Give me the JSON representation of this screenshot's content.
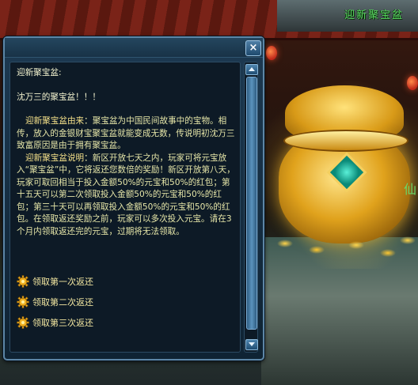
{
  "scene": {
    "title": "迎新聚宝盆",
    "side_char": "仙"
  },
  "dialog": {
    "close_label": "×",
    "heading": "迎新聚宝盆:",
    "greeting": "沈万三的聚宝盆！！！",
    "para1_label": "迎新聚宝盆由来",
    "para1_text": "：聚宝盆为中国民间故事中的宝物。相传，放入的金银财宝聚宝盆就能变成无数，传说明初沈万三致富原因是由于拥有聚宝盆。",
    "para2_label": "迎新聚宝盆说明",
    "para2_text": "：新区开放七天之内，玩家可将元宝放入“聚宝盆”中，它将返还您数倍的奖励！新区开放第八天，玩家可取回相当于投入金额50%的元宝和50%的红包；第十五天可以第二次领取投入金额50%的元宝和50%的红包；第三十天可以再领取投入金额50%的元宝和50%的红包。在领取返还奖励之前，玩家可以多次投入元宝。请在3个月内领取返还完的元宝，过期将无法领取。",
    "actions": [
      {
        "label": "领取第一次返还",
        "icon": "gear-icon"
      },
      {
        "label": "领取第二次返还",
        "icon": "gear-icon"
      },
      {
        "label": "领取第三次返还",
        "icon": "gear-icon"
      }
    ]
  },
  "colors": {
    "panel_bg": "#0d1a26",
    "frame": "#5c86a6",
    "text": "#e6e6a8",
    "highlight": "#f6e28a",
    "scene_title": "#58d860"
  }
}
